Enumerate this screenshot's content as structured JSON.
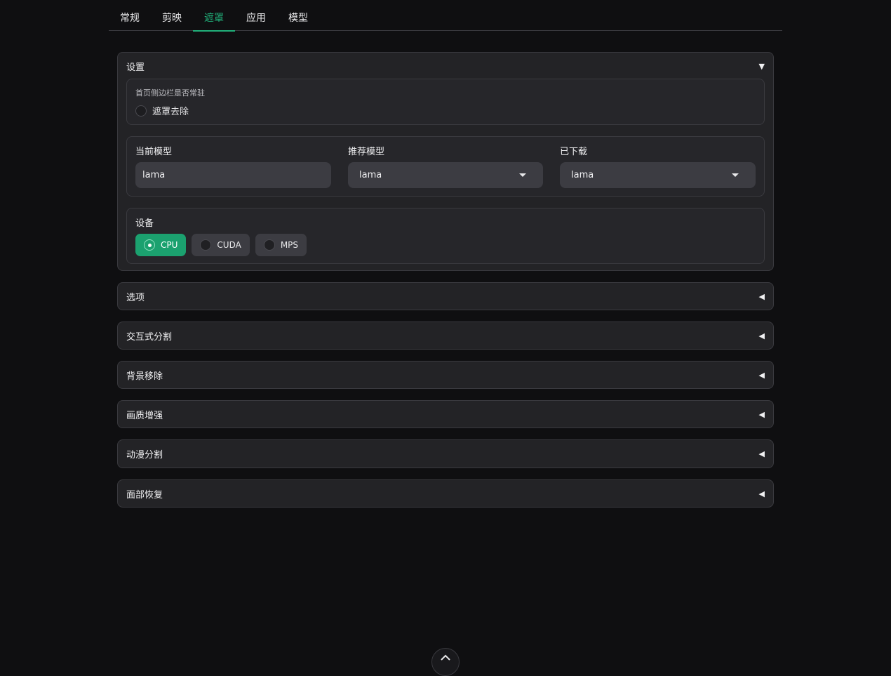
{
  "tabs": [
    "常规",
    "剪映",
    "遮罩",
    "应用",
    "模型"
  ],
  "active_tab": 2,
  "settings": {
    "title": "设置",
    "sidebar_label": "首页侧边栏是否常驻",
    "sidebar_option": "遮罩去除",
    "current_model_label": "当前模型",
    "current_model_value": "lama",
    "recommended_label": "推荐模型",
    "recommended_value": "lama",
    "downloaded_label": "已下载",
    "downloaded_value": "lama",
    "device_label": "设备",
    "devices": [
      "CPU",
      "CUDA",
      "MPS"
    ],
    "selected_device": "CPU"
  },
  "sections": [
    "选项",
    "交互式分割",
    "背景移除",
    "画质增强",
    "动漫分割",
    "面部恢复"
  ],
  "icons": {
    "expanded": "triangle-down-icon",
    "collapsed": "triangle-left-icon",
    "scroll_top": "chevron-up-icon"
  },
  "colors": {
    "accent": "#21b07a",
    "background": "#0f0f11",
    "panel": "#232326"
  }
}
